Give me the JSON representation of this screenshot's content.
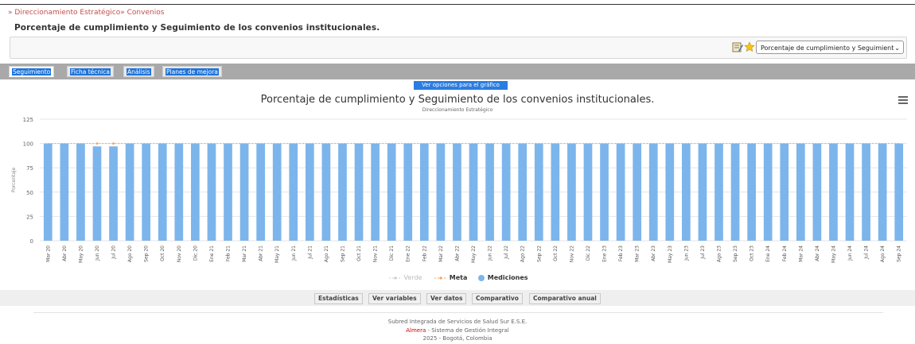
{
  "breadcrumb": {
    "items": [
      "Direccionamiento Estratégico",
      "Convenios"
    ],
    "prefix": "»",
    "separator": "»"
  },
  "page": {
    "title": "Porcentaje de cumplimiento y Seguimiento de los convenios institucionales."
  },
  "toolbar": {
    "icons": [
      "notepad-icon",
      "star-icon"
    ],
    "indicator_select": "Porcentaje de cumplimiento y Seguimient"
  },
  "tabs": [
    {
      "label": "Seguimiento",
      "active": true
    },
    {
      "label": "Ficha técnica",
      "active": false
    },
    {
      "label": "Análisis",
      "active": false
    },
    {
      "label": "Planes de mejora",
      "active": false
    }
  ],
  "chart_options_label": "Ver opciones para el gráfico",
  "chart_data": {
    "type": "bar",
    "title": "Porcentaje de cumplimiento y Seguimiento de los convenios institucionales.",
    "subtitle": "Direccionamiento Estratégico",
    "ylabel": "Porcentaje",
    "xlabel": "",
    "ylim": [
      0,
      125
    ],
    "yticks": [
      0,
      25,
      50,
      75,
      100,
      125
    ],
    "grid": true,
    "legend_position": "bottom-center",
    "categories": [
      "Mar 20",
      "Abr 20",
      "May 20",
      "Jun 20",
      "Jul 20",
      "Ago 20",
      "Sep 20",
      "Oct 20",
      "Nov 20",
      "Dic 20",
      "Ene 21",
      "Feb 21",
      "Mar 21",
      "Abr 21",
      "May 21",
      "Jun 21",
      "Jul 21",
      "Ago 21",
      "Sep 21",
      "Oct 21",
      "Nov 21",
      "Dic 21",
      "Ene 22",
      "Feb 22",
      "Mar 22",
      "Abr 22",
      "May 22",
      "Jun 22",
      "Jul 22",
      "Ago 22",
      "Sep 22",
      "Oct 22",
      "Nov 22",
      "Dic 22",
      "Ene 23",
      "Feb 23",
      "Mar 23",
      "Abr 23",
      "May 23",
      "Jun 23",
      "Jul 23",
      "Ago 23",
      "Sep 23",
      "Oct 23",
      "Ene 24",
      "Feb 24",
      "Mar 24",
      "Abr 24",
      "May 24",
      "Jun 24",
      "Jul 24",
      "Ago 24",
      "Sep 24"
    ],
    "series": [
      {
        "name": "Mediciones",
        "type": "bar",
        "color": "#7cb5ec",
        "values": [
          100,
          100,
          100,
          97,
          97,
          100,
          100,
          100,
          100,
          100,
          100,
          100,
          100,
          100,
          100,
          100,
          100,
          100,
          100,
          100,
          100,
          100,
          100,
          100,
          100,
          100,
          100,
          100,
          100,
          100,
          100,
          100,
          100,
          100,
          100,
          100,
          100,
          100,
          100,
          100,
          100,
          100,
          100,
          100,
          100,
          100,
          100,
          100,
          100,
          100,
          100,
          100,
          100
        ]
      },
      {
        "name": "Meta",
        "type": "line",
        "color": "#f7a35c",
        "dash": true,
        "values": [
          100,
          100,
          100,
          100,
          100,
          100,
          100,
          100,
          100,
          100,
          100,
          100,
          100,
          100,
          100,
          100,
          100,
          100,
          100,
          100,
          100,
          100,
          100,
          100,
          100,
          100,
          100,
          100,
          100,
          100,
          100,
          100,
          100,
          100,
          100,
          100,
          100,
          100,
          100,
          100,
          100,
          100,
          100,
          100,
          100,
          100,
          100,
          100,
          100,
          100,
          100,
          100,
          100
        ]
      },
      {
        "name": "Verde",
        "type": "line",
        "color": "#cccccc",
        "hidden": true,
        "values": []
      }
    ]
  },
  "buttons": [
    "Estadísticas",
    "Ver variables",
    "Ver datos",
    "Comparativo",
    "Comparativo anual"
  ],
  "footer": {
    "line1": "Subred Integrada de Servicios de Salud Sur E.S.E.",
    "brand": "Almera",
    "line2_rest": " - Sistema de Gestión Integral",
    "line3": "2025 - Bogotá, Colombia"
  }
}
